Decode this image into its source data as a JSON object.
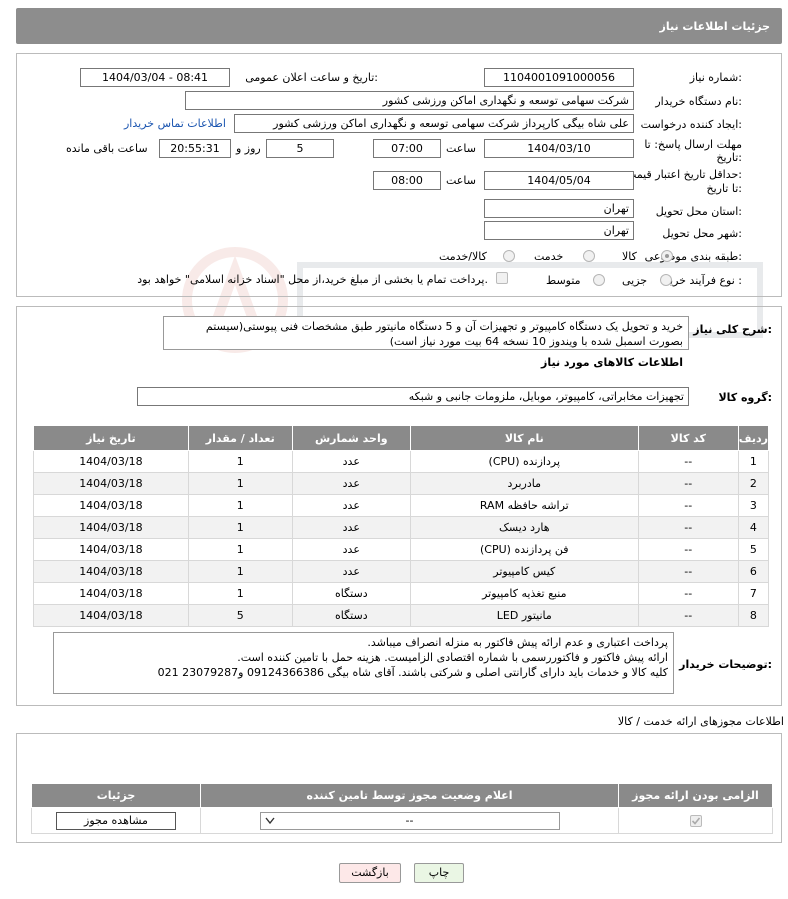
{
  "header": {
    "title": "جزئیات اطلاعات نیاز"
  },
  "form": {
    "need_number": {
      "label": "شماره نیاز:",
      "value": "1104001091000056"
    },
    "announce_datetime": {
      "label": "تاریخ و ساعت اعلان عمومی:",
      "value": "1404/03/04 - 08:41"
    },
    "buyer_org": {
      "label": "نام دستگاه خریدار:",
      "value": "شرکت سهامی توسعه و نگهداری اماکن ورزشی کشور"
    },
    "requester": {
      "label": "ایجاد کننده درخواست:",
      "value": "علی شاه بیگی کارپرداز شرکت سهامی توسعه و نگهداری اماکن ورزشی کشور",
      "contact_link": "اطلاعات تماس خریدار"
    },
    "reply_deadline": {
      "label_line1": "مهلت ارسال پاسخ: تا",
      "label_line2": "تاریخ:",
      "date": "1404/03/10",
      "time_label": "ساعت",
      "time": "07:00",
      "days": "5",
      "days_label": "روز و",
      "remaining": "20:55:31",
      "remaining_label": "ساعت باقی مانده"
    },
    "price_validity": {
      "label_line1": "حداقل تاریخ اعتبار قیمت:",
      "label_line2": "تا تاریخ:",
      "date": "1404/05/04",
      "time_label": "ساعت",
      "time": "08:00"
    },
    "delivery_province": {
      "label": "استان محل تحویل:",
      "value": "تهران"
    },
    "delivery_city": {
      "label": "شهر محل تحویل:",
      "value": "تهران"
    },
    "category": {
      "label": "طبقه بندی موضوعی:",
      "options": [
        "کالا",
        "خدمت",
        "کالا/خدمت"
      ],
      "selected": "کالا"
    },
    "purchase_type": {
      "label": "نوع فرآیند خرید :",
      "options": [
        "جزیی",
        "متوسط"
      ],
      "note": "پرداخت تمام یا بخشی از مبلغ خرید،از محل \"اسناد خزانه اسلامی\" خواهد بود."
    }
  },
  "description": {
    "label": "شرح کلی نیاز:",
    "text": "خرید و تحویل یک دستگاه کامپیوتر و تجهیزات آن و 5 دستگاه مانیتور طبق مشخصات فنی پیوستی(سیستم بصورت اسمبل شده با ویندوز 10 نسخه 64 بیت مورد نیاز است)"
  },
  "goods": {
    "section_title": "اطلاعات کالاهای مورد نیاز",
    "group_label": "گروه کالا:",
    "group_value": "تجهیزات مخابراتی، کامپیوتر، موبایل، ملزومات جانبی و شبکه",
    "columns": [
      "ردیف",
      "کد کالا",
      "نام کالا",
      "واحد شمارش",
      "تعداد / مقدار",
      "تاریخ نیاز"
    ],
    "rows": [
      {
        "idx": "1",
        "code": "--",
        "name": "پردازنده (CPU)",
        "unit": "عدد",
        "qty": "1",
        "date": "1404/03/18"
      },
      {
        "idx": "2",
        "code": "--",
        "name": "مادربرد",
        "unit": "عدد",
        "qty": "1",
        "date": "1404/03/18"
      },
      {
        "idx": "3",
        "code": "--",
        "name": "تراشه حافظه RAM",
        "unit": "عدد",
        "qty": "1",
        "date": "1404/03/18"
      },
      {
        "idx": "4",
        "code": "--",
        "name": "هارد دیسک",
        "unit": "عدد",
        "qty": "1",
        "date": "1404/03/18"
      },
      {
        "idx": "5",
        "code": "--",
        "name": "فن پردازنده (CPU)",
        "unit": "عدد",
        "qty": "1",
        "date": "1404/03/18"
      },
      {
        "idx": "6",
        "code": "--",
        "name": "کیس کامپیوتر",
        "unit": "عدد",
        "qty": "1",
        "date": "1404/03/18"
      },
      {
        "idx": "7",
        "code": "--",
        "name": "منبع تغذیه کامپیوتر",
        "unit": "دستگاه",
        "qty": "1",
        "date": "1404/03/18"
      },
      {
        "idx": "8",
        "code": "--",
        "name": "مانیتور LED",
        "unit": "دستگاه",
        "qty": "5",
        "date": "1404/03/18"
      }
    ]
  },
  "buyer_notes": {
    "label": "توضیحات خریدار:",
    "lines": [
      "پرداخت اعتباری و عدم ارائه پیش فاکتور به منزله انصراف میباشد.",
      "ارائه پیش فاکتور و فاکتوررسمی با شماره اقتصادی الزامیست. هزینه حمل با تامین کننده است.",
      "کلیه کالا و خدمات باید دارای گارانتی اصلی و شرکتی باشند. آقای شاه بیگی 09124366386 و23079287 021"
    ]
  },
  "licenses": {
    "section_title": "اطلاعات مجوزهای ارائه خدمت / کالا",
    "columns": [
      "الزامی بودن ارائه مجوز",
      "اعلام وضعیت مجوز توسط تامین کننده",
      "جزئیات"
    ],
    "select_value": "--",
    "view_button": "مشاهده مجوز"
  },
  "actions": {
    "print": "چاپ",
    "back": "بازگشت"
  },
  "colors": {
    "header_bg": "#8d8d8d",
    "link": "#1b55b0",
    "back_button_bg": "#fde8e8",
    "print_button_bg": "#eaf6e4"
  }
}
